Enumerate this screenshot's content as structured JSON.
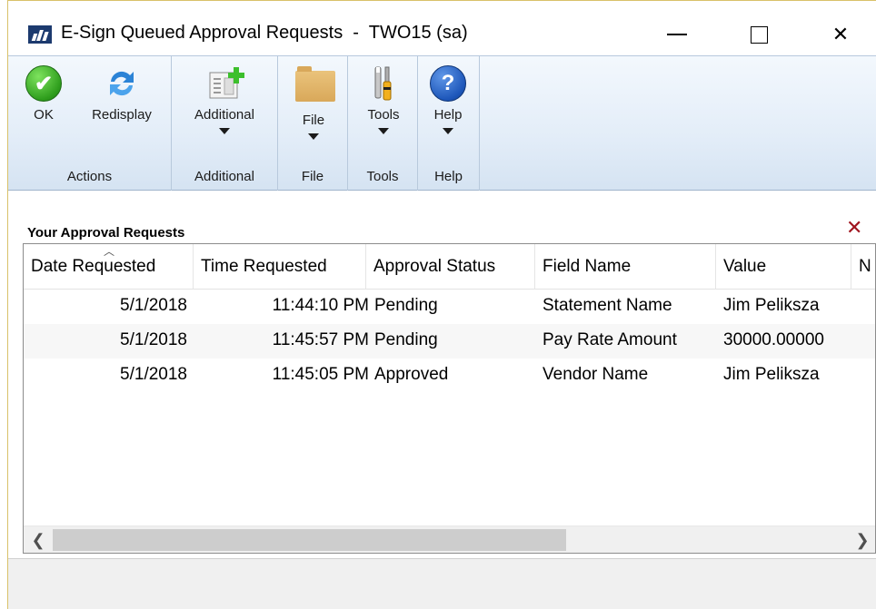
{
  "window": {
    "title": "E-Sign Queued Approval Requests  -  TWO15 (sa)",
    "close_glyph": "✕"
  },
  "ribbon": {
    "groups": [
      {
        "label": "Actions",
        "buttons": [
          {
            "label": "OK",
            "icon": "checkmark-icon",
            "glyph": "✔"
          },
          {
            "label": "Redisplay",
            "icon": "refresh-icon"
          }
        ]
      },
      {
        "label": "Additional",
        "buttons": [
          {
            "label": "Additional",
            "icon": "document-add-icon"
          }
        ]
      },
      {
        "label": "File",
        "buttons": [
          {
            "label": "File",
            "icon": "folder-icon"
          }
        ]
      },
      {
        "label": "Tools",
        "buttons": [
          {
            "label": "Tools",
            "icon": "tools-icon"
          }
        ]
      },
      {
        "label": "Help",
        "buttons": [
          {
            "label": "Help",
            "icon": "help-icon",
            "glyph": "?"
          }
        ]
      }
    ]
  },
  "section": {
    "title": "Your Approval Requests",
    "clear_glyph": "✕"
  },
  "grid": {
    "columns": [
      "Date Requested",
      "Time Requested",
      "Approval Status",
      "Field Name",
      "Value",
      "N"
    ],
    "sort_glyph": "︿",
    "rows": [
      {
        "date": "5/1/2018",
        "time": "11:44:10 PM",
        "status": "Pending",
        "field": "Statement Name",
        "value": "Jim Peliksza"
      },
      {
        "date": "5/1/2018",
        "time": "11:45:57 PM",
        "status": "Pending",
        "field": "Pay Rate Amount",
        "value": "30000.00000"
      },
      {
        "date": "5/1/2018",
        "time": "11:45:05 PM",
        "status": "Approved",
        "field": "Vendor Name",
        "value": "Jim Peliksza"
      }
    ],
    "scroll_left_glyph": "❮",
    "scroll_right_glyph": "❯"
  }
}
